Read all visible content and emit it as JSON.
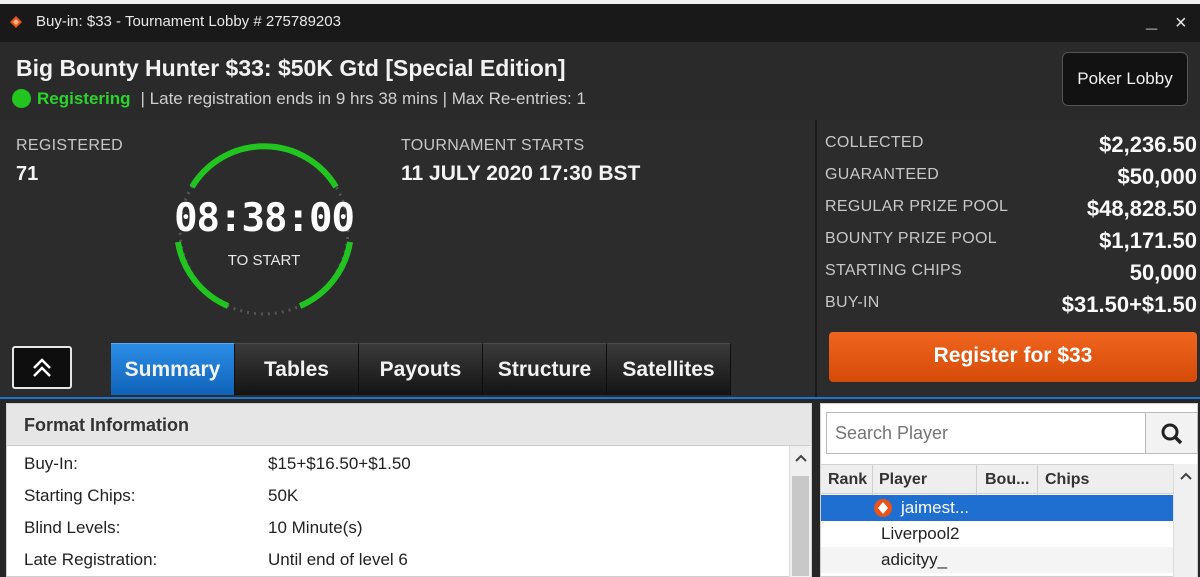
{
  "window": {
    "title": "Buy-in: $33 - Tournament Lobby # 275789203",
    "minimize": "_",
    "close": "×",
    "logo_icon": "diamond-logo-icon"
  },
  "header": {
    "tournament_name": "Big Bounty Hunter $33: $50K Gtd [Special Edition]",
    "status": "Registering",
    "status_color": "#22c51f",
    "late_reg": "| Late registration ends in 9 hrs  38 mins",
    "max_reentries": "| Max Re-entries: 1",
    "poker_lobby_button": "Poker Lobby"
  },
  "summary": {
    "registered_label": "REGISTERED",
    "registered_value": "71",
    "timer": "08:38:00",
    "timer_caption": "TO START",
    "starts_label": "TOURNAMENT STARTS",
    "starts_value": "11 JULY 2020  17:30 BST"
  },
  "stats": [
    {
      "label": "COLLECTED",
      "value": "$2,236.50"
    },
    {
      "label": "GUARANTEED",
      "value": "$50,000"
    },
    {
      "label": "REGULAR PRIZE POOL",
      "value": "$48,828.50"
    },
    {
      "label": "BOUNTY PRIZE POOL",
      "value": "$1,171.50"
    },
    {
      "label": "STARTING CHIPS",
      "value": "50,000"
    },
    {
      "label": "BUY-IN",
      "value": "$31.50+$1.50"
    }
  ],
  "register_button": "Register for  $33",
  "collapse_icon": "double-chevron-up-icon",
  "tabs": [
    {
      "label": "Summary",
      "active": true
    },
    {
      "label": "Tables",
      "active": false
    },
    {
      "label": "Payouts",
      "active": false
    },
    {
      "label": "Structure",
      "active": false
    },
    {
      "label": "Satellites",
      "active": false
    }
  ],
  "format": {
    "title": "Format Information",
    "rows": [
      {
        "key": "Buy-In:",
        "value": "$15+$16.50+$1.50"
      },
      {
        "key": "Starting Chips:",
        "value": "50K"
      },
      {
        "key": "Blind Levels:",
        "value": "10 Minute(s)"
      },
      {
        "key": "Late Registration:",
        "value": "Until end of level 6"
      }
    ]
  },
  "players": {
    "search_placeholder": "Search Player",
    "search_icon": "magnifier-icon",
    "columns": [
      "Rank",
      "Player",
      "Bou...",
      "Chips"
    ],
    "rows": [
      {
        "name": "jaimest...",
        "selected": true,
        "badge": true
      },
      {
        "name": "Liverpool2",
        "selected": false,
        "badge": false
      },
      {
        "name": "adicityy_",
        "selected": false,
        "badge": false
      }
    ]
  },
  "colors": {
    "accent_blue": "#1f6fd1",
    "register_orange": "#e0560f",
    "timer_ring_green": "#22c51f"
  }
}
